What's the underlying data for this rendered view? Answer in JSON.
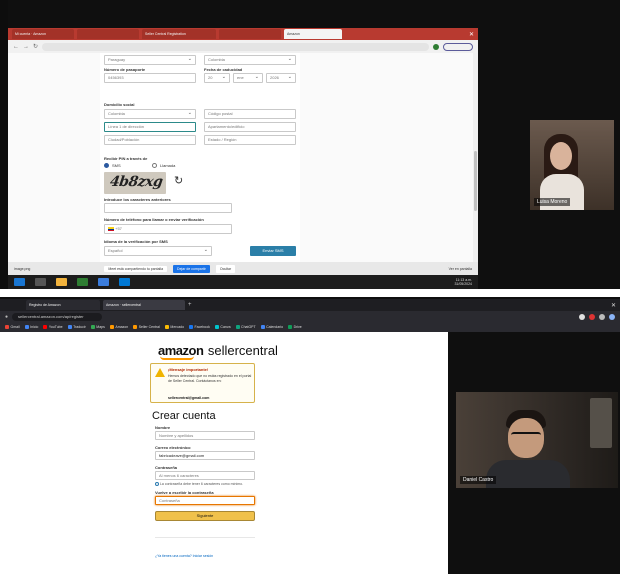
{
  "top": {
    "browser_tabs": [
      "Mi cuenta · Amazon",
      "",
      "Seller Central Registration",
      "",
      "Amazon"
    ],
    "form": {
      "country_select": "Paraguay",
      "country_select_2": "Colombia",
      "passport_label": "Número de pasaporte",
      "passport_value": "0456393",
      "expiry_label": "Fecha de caducidad",
      "expiry_day": "20",
      "expiry_month": "ene",
      "expiry_year": "2026",
      "address_label": "Domicilio social",
      "address_country": "Colombia",
      "address_postcode": "Código postal",
      "address_line1": "Línea 1 de dirección",
      "address_line2": "Apartamento/edificio",
      "address_city": "Ciudad/Población",
      "address_region": "Estado / Región",
      "pin_label": "Recibir PIN a través de",
      "sms_label": "SMS",
      "call_label": "Llamada",
      "captcha_text": "4b8zxg",
      "captcha_input_label": "Introduce los caracteres anteriores",
      "phone_label": "Número de teléfono para llamar o enviar verificación",
      "phone_value": "+57",
      "sms_lang_label": "Idioma de la verificación por SMS",
      "sms_lang_value": "Español",
      "send_sms_button": "Enviar SMS"
    },
    "meet_bar": {
      "left_text": "image.png",
      "middle_text": "Meet está compartiendo tu pantalla",
      "stop_button": "Dejar de compartir",
      "hide_button": "Ocultar",
      "right_text": "Ver en pantalla"
    },
    "participant_name": "Luisa Moreno",
    "clock": "11:13 a.m.",
    "date": "31/05/2024"
  },
  "bottom": {
    "browser_tabs": [
      "Registro de Amazon",
      "Amazon · sellercentral"
    ],
    "url": "sellercentral.amazon.com/ap/register",
    "bookmarks": [
      "Gmail",
      "Inicio",
      "YouTube",
      "Traducir",
      "Maps",
      "Amazon",
      "Seller Central",
      "Mercado",
      "Facebook",
      "Canva",
      "ChatGPT",
      "Calendario",
      "Drive"
    ],
    "logo_word": "amazon",
    "logo_suffix": "sellercentral",
    "notice_title": "¡Mensaje importante!",
    "notice_body": "Hemos detectado que no estás registrado en el portal de Seller Central. Contáctanos en:",
    "notice_email": "sellercentral@gmail.com",
    "heading": "Crear cuenta",
    "name_label": "Nombre",
    "name_placeholder": "Nombre y apellidos",
    "email_label": "Correo electrónico",
    "email_value": "fabricadeave@gmail.com",
    "password_label": "Contraseña",
    "password_placeholder": "Al menos 6 caracteres",
    "password_hint": "La contraseña debe tener 6 caracteres como mínimo.",
    "confirm_label": "Vuelve a escribir la contraseña",
    "confirm_placeholder": "Contraseña",
    "continue_button": "Siguiente",
    "signin_text": "¿Ya tienes una cuenta? Iniciar sesión",
    "participant_name": "Daniel Castro"
  },
  "colors": {
    "amazon_orange": "#ff9900",
    "button_yellow": "#f0c14b",
    "meet_blue": "#1a73e8",
    "top_tab_bg": "#c0392b",
    "dark_bg": "#0f0f0f"
  }
}
